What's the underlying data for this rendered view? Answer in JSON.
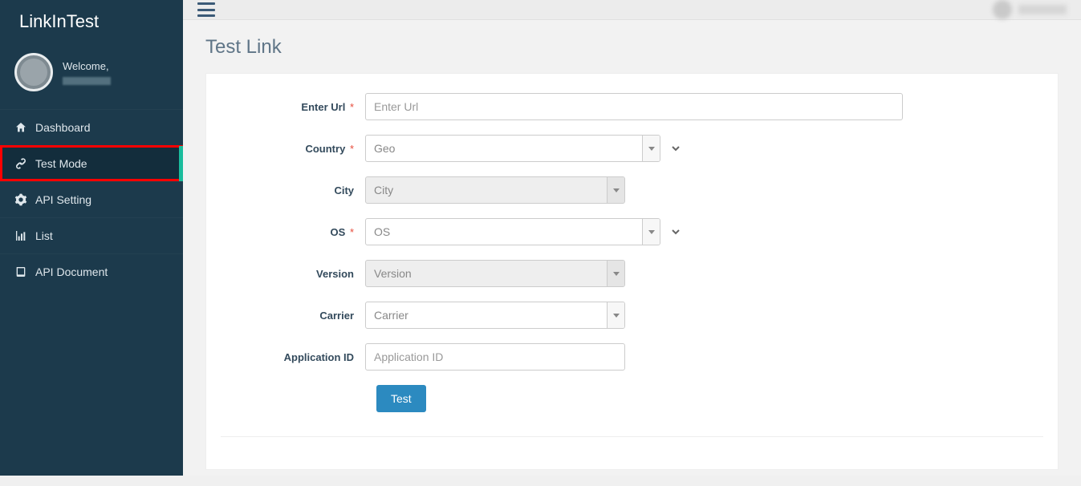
{
  "brand": "LinkInTest",
  "profile": {
    "welcome": "Welcome,"
  },
  "nav": {
    "dashboard": "Dashboard",
    "testmode": "Test Mode",
    "apisetting": "API Setting",
    "list": "List",
    "apidoc": "API Document"
  },
  "page": {
    "title": "Test Link"
  },
  "form": {
    "labels": {
      "url": "Enter Url",
      "country": "Country",
      "city": "City",
      "os": "OS",
      "version": "Version",
      "carrier": "Carrier",
      "appid": "Application ID"
    },
    "placeholders": {
      "url": "Enter Url",
      "country": "Geo",
      "city": "City",
      "os": "OS",
      "version": "Version",
      "carrier": "Carrier",
      "appid": "Application ID"
    },
    "required_mark": "*",
    "submit": "Test"
  }
}
